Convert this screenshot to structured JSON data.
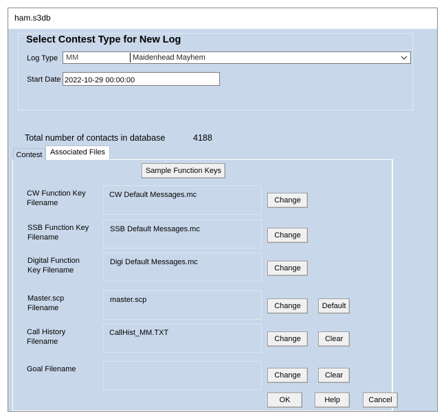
{
  "window": {
    "title": "ham.s3db"
  },
  "header": {
    "title": "Select Contest Type for New Log"
  },
  "log_type": {
    "label": "Log Type",
    "code": "MM",
    "name": "Maidenhead Mayhem"
  },
  "start_date": {
    "label": "Start Date",
    "value": "2022-10-29 00:00:00"
  },
  "totals": {
    "label": "Total number of contacts in database",
    "value": "4188"
  },
  "tabs": [
    {
      "label": "Contest"
    },
    {
      "label": "Associated Files",
      "active": true
    }
  ],
  "sample_button": "Sample Function Keys",
  "files": [
    {
      "label_line1": "CW Function Key",
      "label_line2": "Filename",
      "value": "CW Default Messages.mc",
      "buttons": [
        "Change"
      ]
    },
    {
      "label_line1": "SSB Function Key",
      "label_line2": "Filename",
      "value": "SSB Default Messages.mc",
      "buttons": [
        "Change"
      ]
    },
    {
      "label_line1": "Digital Function",
      "label_line2": "Key Filename",
      "value": "Digi Default Messages.mc",
      "buttons": [
        "Change"
      ]
    },
    {
      "label_line1": "Master.scp",
      "label_line2": "Filename",
      "value": "master.scp",
      "buttons": [
        "Change",
        "Default"
      ]
    },
    {
      "label_line1": "Call History",
      "label_line2": "Filename",
      "value": "CallHist_MM.TXT",
      "buttons": [
        "Change",
        "Clear"
      ]
    },
    {
      "label_line1": "Goal Filename",
      "label_line2": "",
      "value": "",
      "buttons": [
        "Change",
        "Clear"
      ]
    }
  ],
  "footer": {
    "ok": "OK",
    "help": "Help",
    "cancel": "Cancel"
  },
  "colors": {
    "client_bg": "#c9d7ea",
    "button_bg": "#f0f0f0"
  }
}
